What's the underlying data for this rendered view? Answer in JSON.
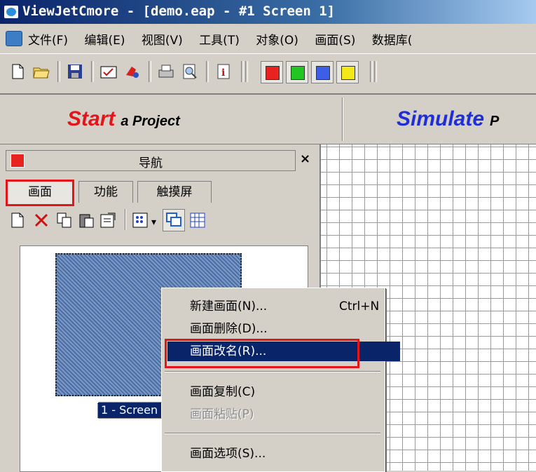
{
  "window": {
    "title": "ViewJetCmore - [demo.eap - #1 Screen 1]"
  },
  "menubar": {
    "items": [
      "文件(F)",
      "编辑(E)",
      "视图(V)",
      "工具(T)",
      "对象(O)",
      "画面(S)",
      "数据库("
    ]
  },
  "toolbar": {
    "icons": [
      "new-file-icon",
      "open-folder-icon",
      "save-icon",
      "checkbox-icon",
      "flag-icon",
      "print-icon",
      "print-preview-icon",
      "info-icon"
    ],
    "colors": [
      "#e8221e",
      "#22c522",
      "#3d5ee8",
      "#f2e81a"
    ]
  },
  "strip": {
    "start_big": "Start",
    "start_small": "a Project",
    "simulate_big": "Simulate",
    "simulate_small": "P",
    "start_color": "#e4141b",
    "simulate_color": "#1f2fd8"
  },
  "nav": {
    "title": "导航",
    "close": "×",
    "tabs": [
      "画面",
      "功能",
      "触摸屏"
    ],
    "tools": [
      "new-page-icon",
      "delete-icon",
      "copy-icon",
      "paste-icon",
      "properties-icon",
      "view-icon",
      "dropdown-icon",
      "window-icon",
      "grid-icon"
    ],
    "thumbnail_label": "1 - Screen 1"
  },
  "context_menu": {
    "items": [
      {
        "label": "新建画面(N)...",
        "shortcut": "Ctrl+N",
        "enabled": true
      },
      {
        "label": "画面删除(D)...",
        "shortcut": "",
        "enabled": true
      },
      {
        "label": "画面改名(R)...",
        "shortcut": "",
        "enabled": true,
        "highlighted": true
      },
      {
        "label": "画面复制(C)",
        "shortcut": "",
        "enabled": true
      },
      {
        "label": "画面粘贴(P)",
        "shortcut": "",
        "enabled": false
      },
      {
        "label": "画面选项(S)...",
        "shortcut": "",
        "enabled": true
      }
    ]
  }
}
